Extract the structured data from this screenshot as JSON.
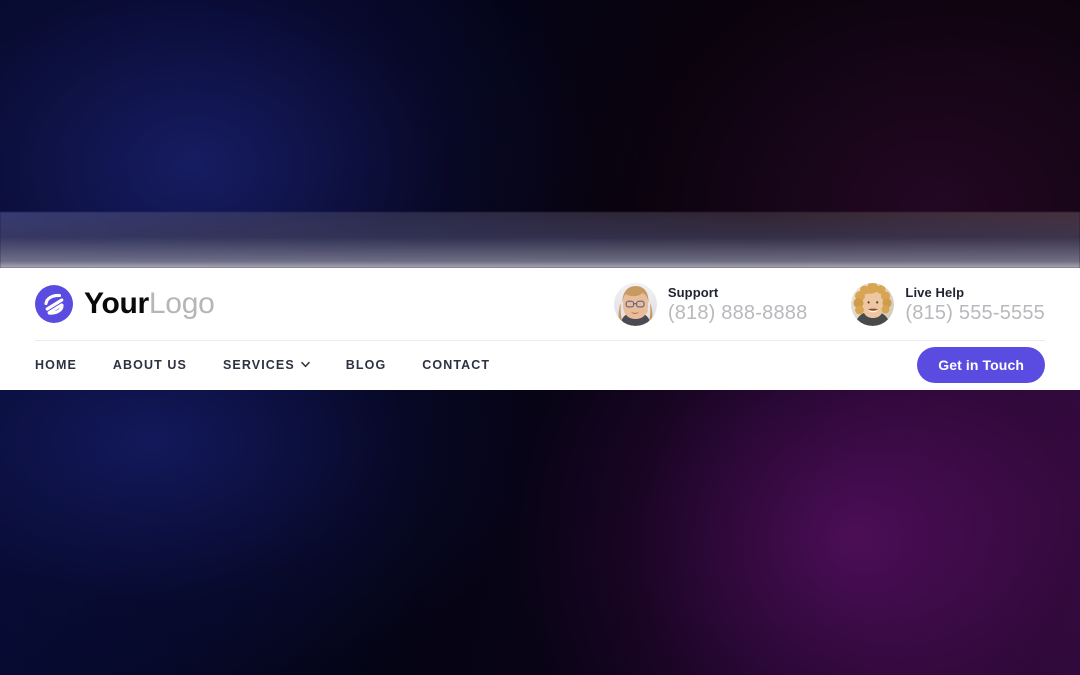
{
  "brand": {
    "name_strong": "Your",
    "name_light": "Logo",
    "logo_icon": "circle-s-mark-icon",
    "logo_color": "#5a4ce0"
  },
  "contacts": [
    {
      "label": "Support",
      "phone": "(818) 888-8888",
      "avatar_name": "avatar-support-woman-glasses"
    },
    {
      "label": "Live Help",
      "phone": "(815) 555-5555",
      "avatar_name": "avatar-live-help-woman-curly-hair"
    }
  ],
  "nav": {
    "items": [
      {
        "label": "HOME",
        "has_dropdown": false
      },
      {
        "label": "ABOUT US",
        "has_dropdown": false
      },
      {
        "label": "SERVICES",
        "has_dropdown": true,
        "dropdown_icon": "chevron-down-icon"
      },
      {
        "label": "BLOG",
        "has_dropdown": false
      },
      {
        "label": "CONTACT",
        "has_dropdown": false
      }
    ]
  },
  "cta": {
    "label": "Get in Touch",
    "background": "#5a4ce0",
    "text_color": "#ffffff"
  },
  "theme": {
    "header_background": "#ffffff",
    "nav_text_color": "#2d3142",
    "phone_text_color": "#b9b9bd",
    "label_text_color": "#1f2230",
    "brand_light_color": "#b6b6b6",
    "hero_top_gradient": "#060a2e to #0a0309",
    "hero_bottom_gradient": "#070c36 to #2a0a38"
  }
}
